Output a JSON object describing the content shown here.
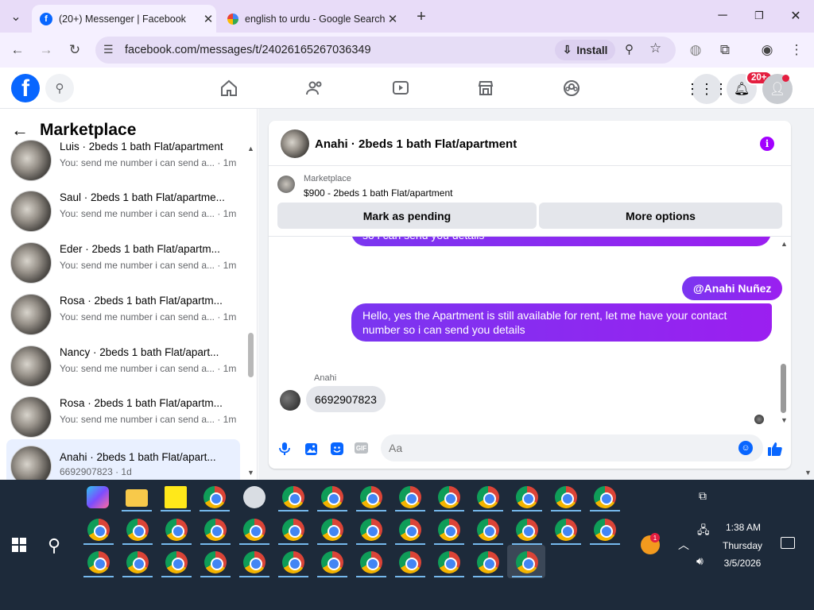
{
  "browser": {
    "tabs": [
      {
        "title": "(20+) Messenger | Facebook"
      },
      {
        "title": "english to urdu - Google Search"
      }
    ],
    "url": "facebook.com/messages/t/24026165267036349",
    "install_label": "Install"
  },
  "fb": {
    "notification_badge": "20+",
    "brand_color": "#0866ff"
  },
  "marketplace": {
    "title": "Marketplace",
    "conversations": [
      {
        "name": "Luis · 2beds 1 bath Flat/apartment",
        "preview": "You: send me number i can send a... · 1m",
        "selected": false
      },
      {
        "name": "Saul · 2beds 1 bath Flat/apartme...",
        "preview": "You: send me number i can send a... · 1m",
        "selected": false
      },
      {
        "name": "Eder · 2beds 1 bath Flat/apartm...",
        "preview": "You: send me number i can send a... · 1m",
        "selected": false
      },
      {
        "name": "Rosa · 2beds 1 bath Flat/apartm...",
        "preview": "You: send me number i can send a... · 1m",
        "selected": false
      },
      {
        "name": "Nancy · 2beds 1 bath Flat/apart...",
        "preview": "You: send me number i can send a... · 1m",
        "selected": false
      },
      {
        "name": "Rosa · 2beds 1 bath Flat/apartm...",
        "preview": "You: send me number i can send a... · 1m",
        "selected": false
      },
      {
        "name": "Anahi · 2beds 1 bath Flat/apart...",
        "preview": "6692907823 · 1d",
        "selected": true
      }
    ]
  },
  "chat": {
    "title": "Anahi · 2beds 1 bath Flat/apartment",
    "listing_source": "Marketplace",
    "listing_price": "$900 - 2beds 1 bath Flat/apartment",
    "mark_pending_label": "Mark as pending",
    "more_options_label": "More options",
    "cutoff_text": "so i can send you details",
    "mention": "@Anahi Nuñez",
    "outgoing_message": "Hello, yes the Apartment is still available for rent, let me have your contact number so i can send you details",
    "sender_name": "Anahi",
    "incoming_message": "6692907823",
    "input_placeholder": "Aa"
  },
  "taskbar": {
    "time": "1:38 AM",
    "day": "Thursday",
    "date": "3/5/2026",
    "tray_badge": "1"
  }
}
